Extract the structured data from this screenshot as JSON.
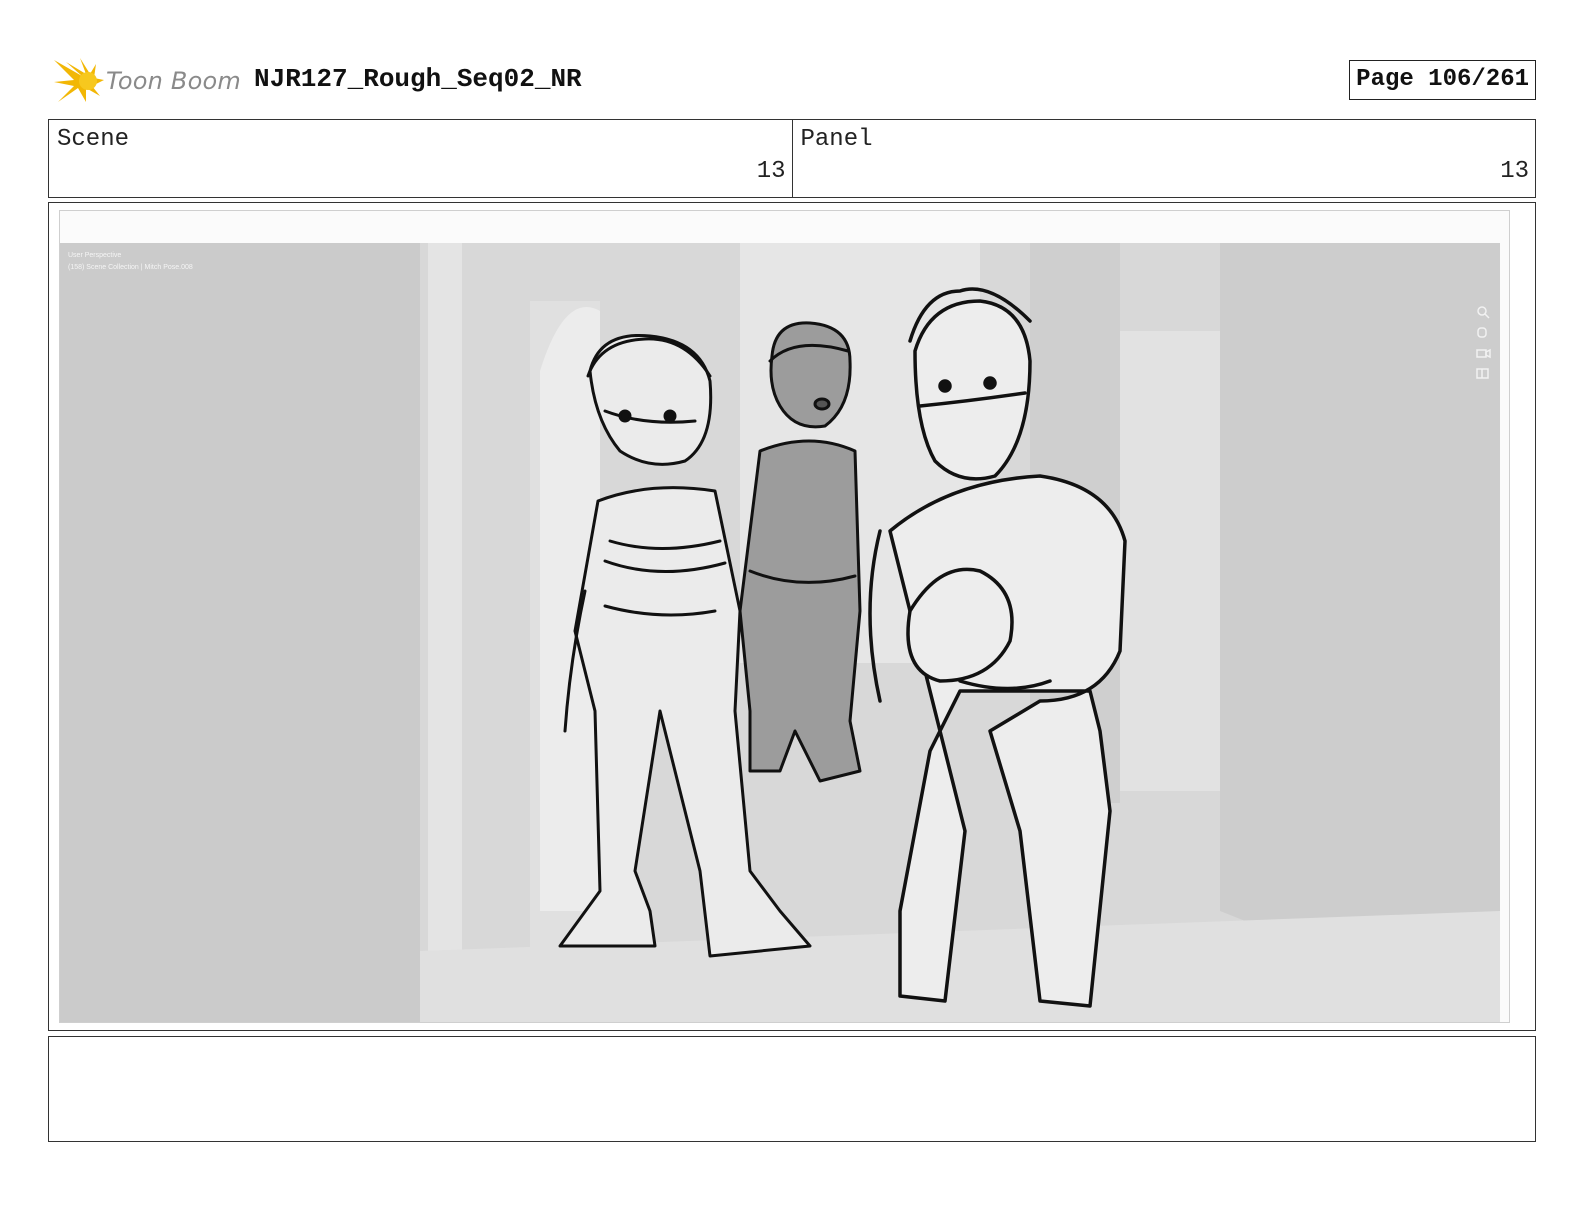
{
  "header": {
    "logo_text": "Toon Boom",
    "title": "NJR127_Rough_Seq02_NR",
    "page": "Page 106/261"
  },
  "info": {
    "scene_label": "Scene",
    "scene_value": "13",
    "panel_label": "Panel",
    "panel_value": "13"
  },
  "panel": {
    "viewport_line1": "User Perspective",
    "viewport_line2": "(158) Scene Collection | Mitch Pose.008"
  },
  "notes": {
    "text": ""
  },
  "colors": {
    "logo_star": "#f2b705",
    "border": "#333333",
    "viewport_bg": "#d4d4d4"
  },
  "icons": [
    "toon-boom-star-icon",
    "zoom-icon",
    "hand-icon",
    "camera-icon",
    "grid-icon"
  ]
}
